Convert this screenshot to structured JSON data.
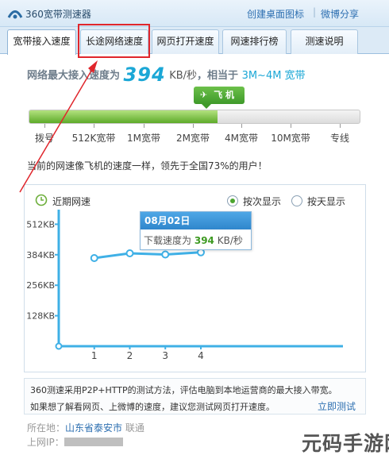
{
  "window": {
    "title": "360宽带测速器",
    "links": [
      "创建桌面图标",
      "微博分享"
    ],
    "separator": "|"
  },
  "tabs": [
    {
      "label": "宽带接入速度",
      "active": true
    },
    {
      "label": "长途网络速度",
      "active": false
    },
    {
      "label": "网页打开速度",
      "active": false
    },
    {
      "label": "网速排行榜",
      "active": false
    },
    {
      "label": "测速说明",
      "active": false
    }
  ],
  "headline": {
    "prefix": "网络最大接入速度为",
    "speed": "394",
    "unit": "KB/秒",
    "middle": "，相当于",
    "bandwidth": "3M~4M 宽带"
  },
  "badge": {
    "icon": "airplane-icon",
    "label": "飞 机"
  },
  "gauge": {
    "fill_fraction": 0.57,
    "labels": [
      "拨号",
      "512K宽带",
      "1M宽带",
      "2M宽带",
      "4M宽带",
      "10M宽带",
      "专线"
    ]
  },
  "compare_text": "当前的网速像飞机的速度一样，领先于全国73%的用户！",
  "chart_panel": {
    "heading": "近期网速",
    "options": [
      {
        "label": "按次显示",
        "checked": true
      },
      {
        "label": "按天显示",
        "checked": false
      }
    ],
    "tooltip": {
      "date": "08月02日",
      "text": "下载速度为",
      "value": "394",
      "unit": "KB/秒"
    }
  },
  "chart_data": {
    "type": "line",
    "x": [
      1,
      2,
      3,
      4
    ],
    "series": [
      {
        "values": [
          370,
          390,
          385,
          394
        ]
      }
    ],
    "yticks": [
      "128KB",
      "256KB",
      "384KB",
      "512KB"
    ],
    "xticks": [
      "1",
      "2",
      "3",
      "4"
    ],
    "ylim": [
      0,
      560
    ],
    "xlim": [
      0,
      8
    ],
    "color": "#3fb0e6",
    "grid": false
  },
  "note": {
    "line1": "360测速采用P2P+HTTP的测试方法，评估电脑到本地运营商的最大接入带宽。",
    "line2": "如果想了解看网页、上微博的速度，建议您测试网页打开速度。",
    "link": "立即测试"
  },
  "footer": {
    "location_label": "所在地：",
    "location": "山东省泰安市",
    "isp": "联通",
    "ip_label": "上网IP："
  },
  "watermark": "元码手游网",
  "colors": {
    "accent": "#1ba7d6",
    "line": "#3fb0e6",
    "green": "#5eaa2a",
    "annotation": "#e0262c"
  }
}
